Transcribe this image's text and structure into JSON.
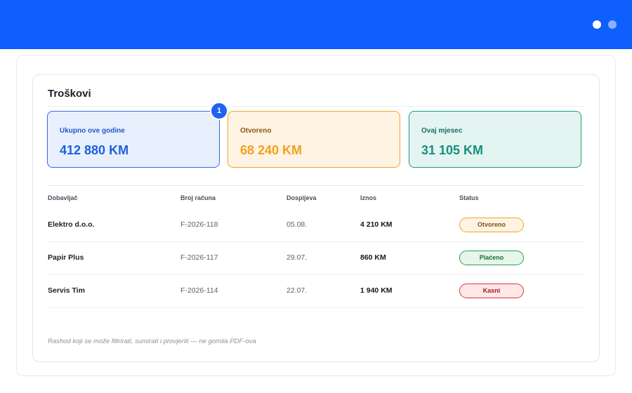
{
  "window": {
    "dots": [
      "window-dot-1",
      "window-dot-2"
    ]
  },
  "card": {
    "title": "Troškovi"
  },
  "stats": [
    {
      "label": "Ukupno ove godine",
      "value": "412 880 KM"
    },
    {
      "label": "Otvoreno",
      "value": "68 240 KM"
    },
    {
      "label": "Ovaj mjesec",
      "value": "31 105 KM"
    }
  ],
  "step_badge": "1",
  "table": {
    "headers": [
      "Dobavljač",
      "Broj računa",
      "Dospijeva",
      "Iznos",
      "Status"
    ],
    "rows": [
      {
        "vendor": "Elektro d.o.o.",
        "invoice": "F-2026-118",
        "due": "05.08.",
        "amount": "4 210 KM",
        "status": "Otvoreno"
      },
      {
        "vendor": "Papir Plus",
        "invoice": "F-2026-117",
        "due": "29.07.",
        "amount": "860 KM",
        "status": "Plaćeno"
      },
      {
        "vendor": "Servis Tim",
        "invoice": "F-2026-114",
        "due": "22.07.",
        "amount": "1 940 KM",
        "status": "Kasni"
      }
    ]
  },
  "footnote": "Rashod koji se može filtrirati, sumirati i provjeriti — ne gomila PDF-ova",
  "colors": {
    "topbar": "#0e5ffb",
    "accent_blue": "#1e5fe0",
    "accent_orange": "#f0a21f",
    "accent_teal": "#14917d",
    "status_open": "#f1a42b",
    "status_paid": "#2f9d4e",
    "status_late": "#d83a3a"
  }
}
